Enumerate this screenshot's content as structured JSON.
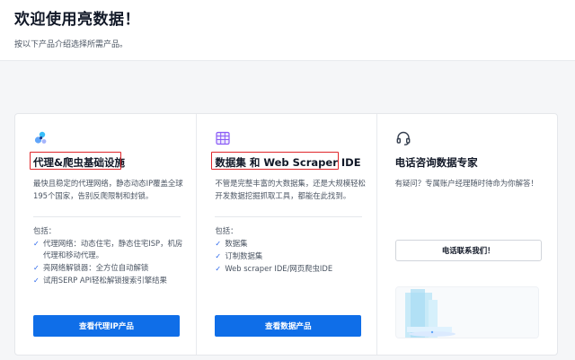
{
  "header": {
    "title": "欢迎使用亮数据！",
    "subtitle": "按以下产品介绍选择所需产品。"
  },
  "cards": [
    {
      "icon": "proxy-nodes-icon",
      "title": "代理&爬虫基础设施",
      "description": "最快且稳定的代理网络，静态动态IP覆盖全球195个国家，告别反爬限制和封锁。",
      "includes_label": "包括：",
      "features": [
        "代理网络：动态住宅，静态住宅ISP，机房代理和移动代理。",
        "亮网络解锁器：全方位自动解锁",
        "试用SERP API轻松解锁搜索引擎结果"
      ],
      "button_label": "查看代理IP产品"
    },
    {
      "icon": "dataset-table-icon",
      "title": "数据集 和 Web Scraper IDE",
      "description": "不管是完整丰富的大数据集，还是大规模轻松开发数据挖掘抓取工具，都能在此找到。",
      "includes_label": "包括：",
      "features": [
        "数据集",
        "订制数据集",
        "Web scraper IDE/网页爬虫IDE"
      ],
      "button_label": "查看数据产品"
    },
    {
      "icon": "headset-icon",
      "title": "电话咨询数据专家",
      "description": "有疑问？专属账户经理随时待命为你解答！",
      "button_label": "电话联系我们！"
    }
  ],
  "colors": {
    "primary": "#0f6ee8",
    "highlight": "#e0262a",
    "check": "#2563eb"
  }
}
